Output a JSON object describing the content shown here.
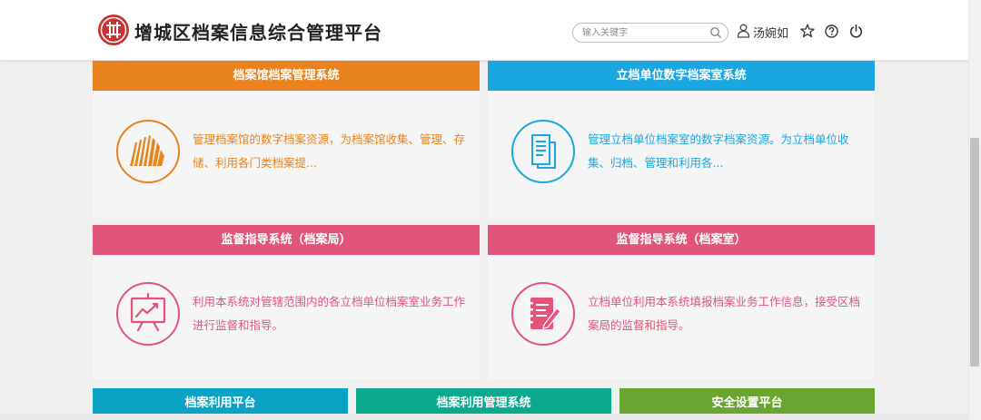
{
  "header": {
    "title": "增城区档案信息综合管理平台",
    "search_placeholder": "输入关键字",
    "user_name": "汤婉如"
  },
  "colors": {
    "orange": "#e8831d",
    "blue": "#1aa6e0",
    "pink": "#e2547a",
    "teal": "#0aa3c6",
    "green": "#0aa98d",
    "olive": "#6aa531"
  },
  "cards": [
    {
      "title": "档案馆档案管理系统",
      "desc": "管理档案馆的数字档案资源，为档案馆收集、管理、存储、利用各门类档案提..."
    },
    {
      "title": "立档单位数字档案室系统",
      "desc": "管理立档单位档案室的数字档案资源。为立档单位收集、归档、管理和利用各..."
    },
    {
      "title": "监督指导系统（档案局）",
      "desc": "利用本系统对管辖范围内的各立档单位档案室业务工作进行监督和指导。"
    },
    {
      "title": "监督指导系统（档案室）",
      "desc": "立档单位利用本系统填报档案业务工作信息，接受区档案局的监督和指导。"
    }
  ],
  "bottom_cards": [
    {
      "title": "档案利用平台"
    },
    {
      "title": "档案利用管理系统"
    },
    {
      "title": "安全设置平台"
    }
  ],
  "icons": {
    "card1": "archive-building-icon",
    "card2": "document-pages-icon",
    "card3": "presentation-chart-icon",
    "card4": "notebook-pen-icon"
  }
}
